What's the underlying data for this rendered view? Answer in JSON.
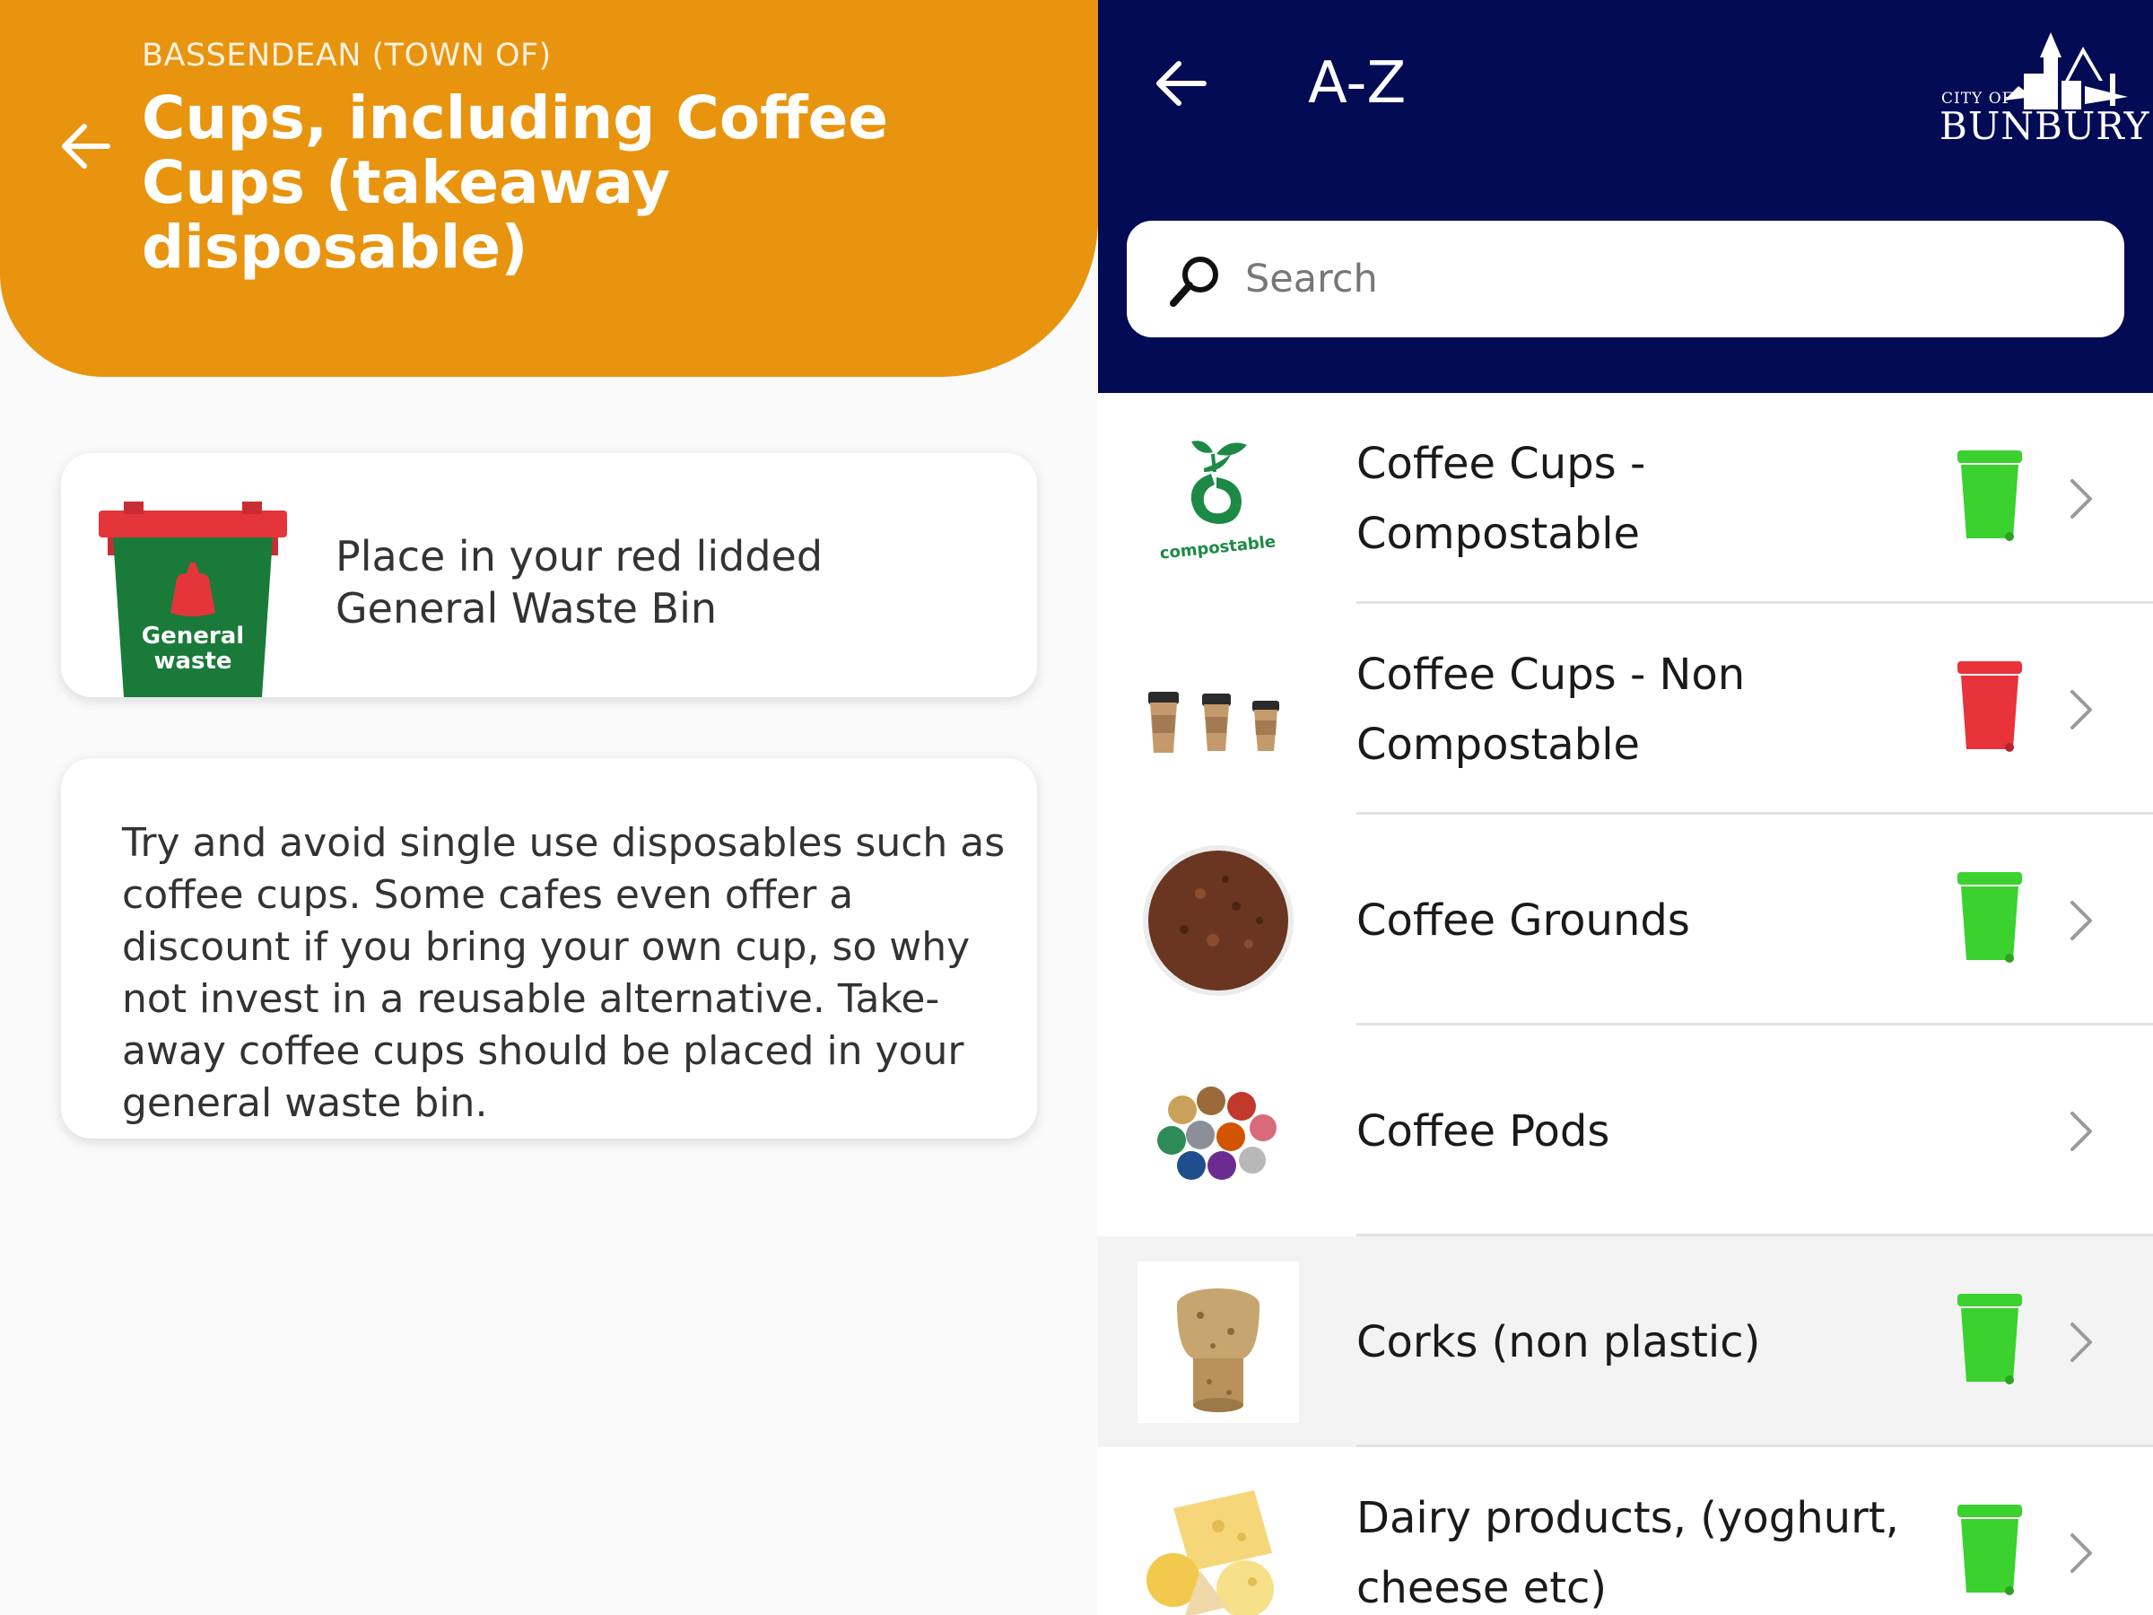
{
  "left": {
    "council": "BASSENDEAN (TOWN OF)",
    "item_title": "Cups, including Coffee Cups (takeaway disposable)",
    "bin_card": {
      "bin_label_line1": "General",
      "bin_label_line2": "waste",
      "instruction": "Place in your red lidded General Waste Bin",
      "bin_body_color": "#1a7a3a",
      "bin_lid_color": "#e4353a"
    },
    "tip_text": "Try and avoid single use disposables such as coffee cups. Some cafes even offer a discount if you bring your own cup, so why not invest in a reusable alternative. Take-away coffee cups should be placed in your general waste bin.",
    "header_color": "#e8940f"
  },
  "right": {
    "title": "A-Z",
    "logo": {
      "city_of": "CITY OF",
      "name": "BUNBURY"
    },
    "search": {
      "placeholder": "Search",
      "value": ""
    },
    "header_color": "#020b54",
    "items": [
      {
        "label": "Coffee Cups - Compostable",
        "thumb": "compostable-logo-icon",
        "thumb_text": "compostable",
        "bin": "green"
      },
      {
        "label": "Coffee Cups - Non Compostable",
        "thumb": "coffee-cups-icon",
        "bin": "red"
      },
      {
        "label": "Coffee Grounds",
        "thumb": "coffee-grounds-icon",
        "bin": "green"
      },
      {
        "label": "Coffee Pods",
        "thumb": "coffee-pods-icon",
        "bin": "none"
      },
      {
        "label": "Corks (non plastic)",
        "thumb": "cork-icon",
        "bin": "green",
        "highlighted": true
      },
      {
        "label": "Dairy products, (yoghurt, cheese etc)",
        "thumb": "cheese-icon",
        "bin": "green"
      }
    ],
    "bin_colors": {
      "green": "#3bd12f",
      "red": "#e8333b"
    }
  }
}
